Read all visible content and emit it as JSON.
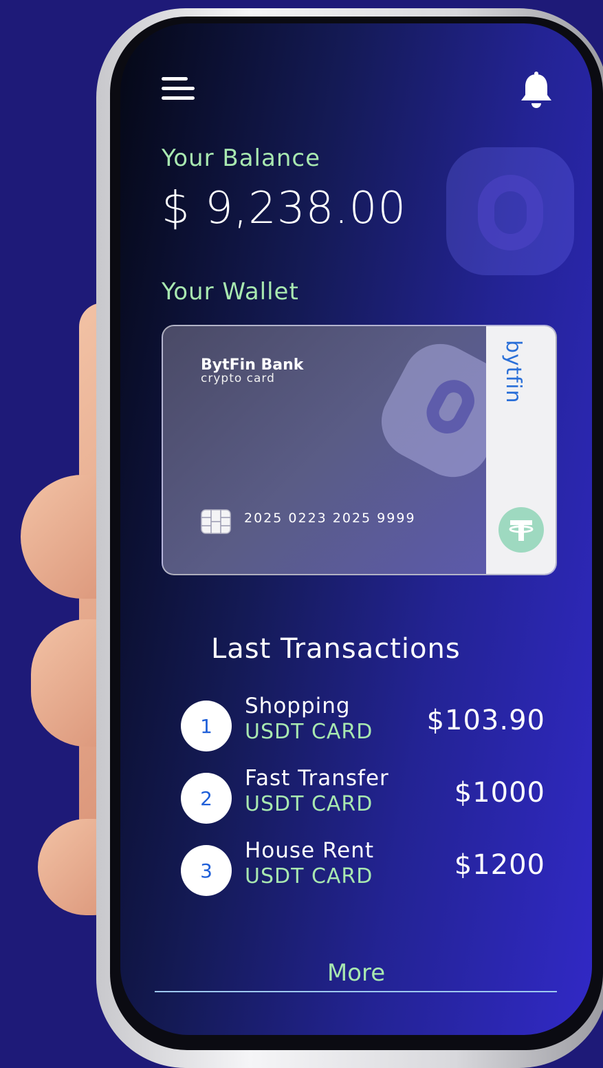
{
  "header": {
    "menu_icon": "hamburger-menu-icon",
    "bell_icon": "bell-icon"
  },
  "balance": {
    "label": "Your Balance",
    "value": "$ 9,238.00"
  },
  "wallet": {
    "label": "Your Wallet",
    "card": {
      "bank_name": "BytFin Bank",
      "card_type": "crypto card",
      "number": "2025 0223 2025 9999",
      "brand_strip": "bytfin",
      "chip_icon": "sim-chip-icon",
      "coin_icon": "tether-icon"
    }
  },
  "transactions": {
    "title": "Last Transactions",
    "items": [
      {
        "index": "1",
        "name": "Shopping",
        "method": "USDT CARD",
        "amount": "$103.90"
      },
      {
        "index": "2",
        "name": "Fast Transfer",
        "method": "USDT CARD",
        "amount": "$1000"
      },
      {
        "index": "3",
        "name": "House Rent",
        "method": "USDT CARD",
        "amount": "$1200"
      }
    ],
    "more_label": "More"
  },
  "colors": {
    "accent_green": "#a8e8b0",
    "brand_blue": "#2a6fd8",
    "background": "#1e1a78",
    "tether": "#9ed9c0"
  }
}
